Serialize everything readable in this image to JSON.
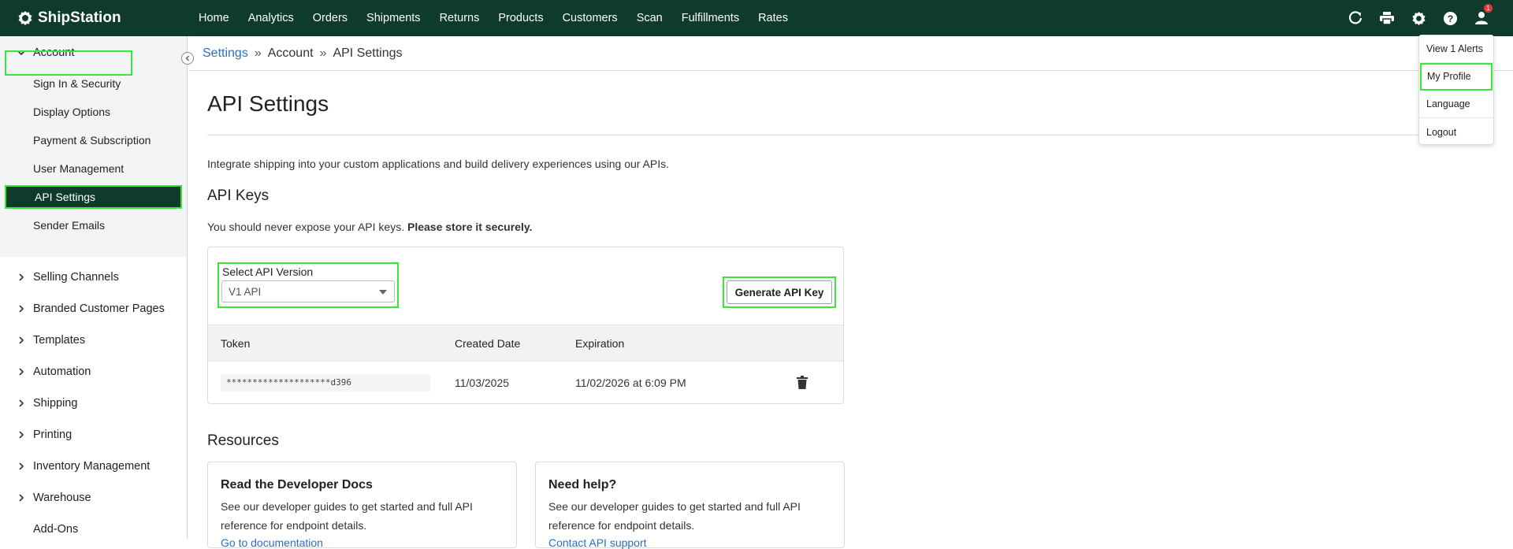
{
  "app": {
    "brand": "ShipStation"
  },
  "nav": [
    "Home",
    "Analytics",
    "Orders",
    "Shipments",
    "Returns",
    "Products",
    "Customers",
    "Scan",
    "Fulfillments",
    "Rates"
  ],
  "top_icons": {
    "refresh": "refresh-icon",
    "print": "printer-icon",
    "settings": "gear-icon",
    "help": "help-icon",
    "user": "user-icon",
    "alert_count": "1"
  },
  "profile_menu": [
    "View 1 Alerts",
    "My Profile",
    "Language",
    "Logout"
  ],
  "sidebar": {
    "account": "Account",
    "account_items": [
      "Sign In & Security",
      "Display Options",
      "Payment & Subscription",
      "User Management",
      "API Settings",
      "Sender Emails"
    ],
    "groups": [
      "Selling Channels",
      "Branded Customer Pages",
      "Templates",
      "Automation",
      "Shipping",
      "Printing",
      "Inventory Management",
      "Warehouse",
      "Add-Ons"
    ]
  },
  "breadcrumb": {
    "root": "Settings",
    "mid": "Account",
    "current": "API Settings"
  },
  "page": {
    "title": "API Settings",
    "intro": "Integrate shipping into your custom applications and build delivery experiences using our APIs.",
    "keys_heading": "API Keys",
    "warning": "You should never expose your API keys.",
    "warning_bold": "Please store it securely."
  },
  "api_card": {
    "version_label": "Select API Version",
    "version_value": "V1 API",
    "generate_label": "Generate API Key",
    "columns": {
      "token": "Token",
      "created": "Created Date",
      "expiration": "Expiration"
    },
    "row": {
      "token": "********************d396",
      "created": "11/03/2025",
      "expiration": "11/02/2026 at 6:09 PM"
    }
  },
  "resources": {
    "heading": "Resources",
    "cards": [
      {
        "title": "Read the Developer Docs",
        "body": "See our developer guides to get started and full API reference for endpoint details.",
        "link": "Go to documentation"
      },
      {
        "title": "Need help?",
        "body": "See our developer guides to get started and full API reference for endpoint details.",
        "link": "Contact API support"
      }
    ]
  },
  "colors": {
    "header_bg": "#0e3b2b",
    "highlight": "#39e639",
    "link": "#2b6fc4"
  }
}
